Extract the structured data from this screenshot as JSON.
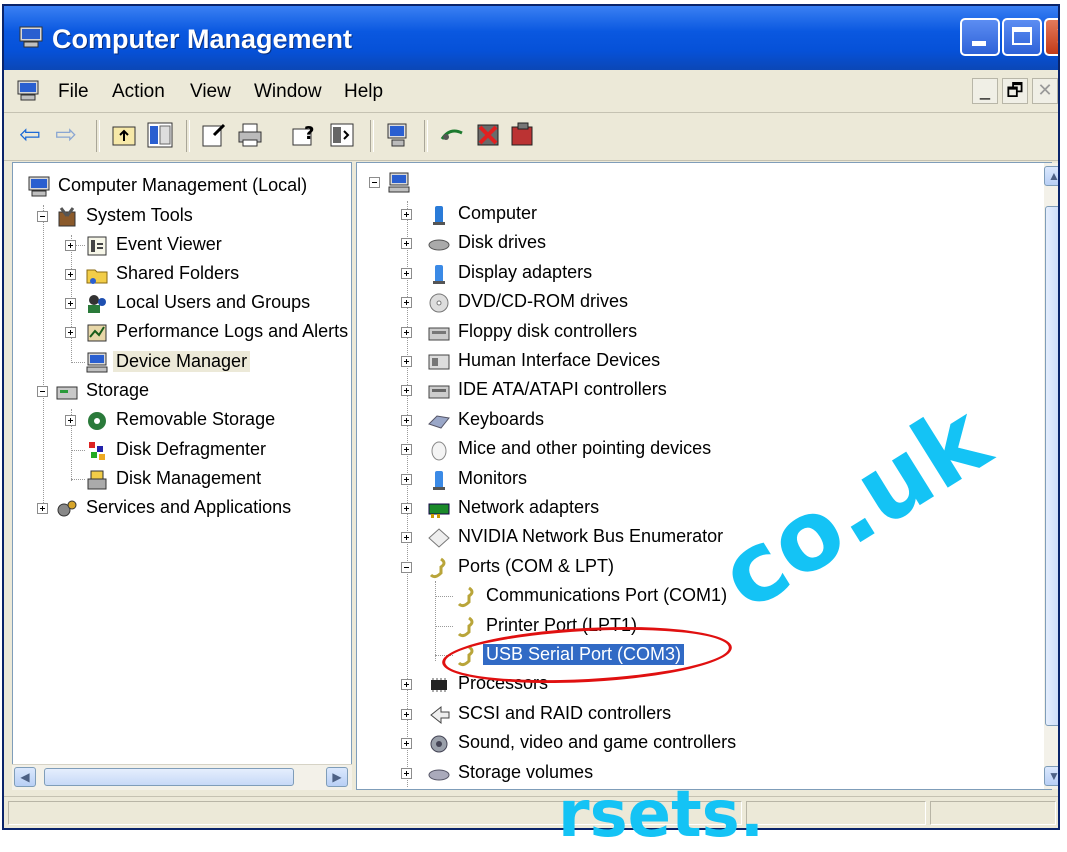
{
  "window": {
    "title": "Computer Management"
  },
  "menu": {
    "items": [
      "File",
      "Action",
      "View",
      "Window",
      "Help"
    ]
  },
  "mdi_controls": [
    "_",
    "🗗",
    "✕"
  ],
  "left_tree": [
    {
      "label": "Computer Management (Local)",
      "icon": "computer-icon",
      "level": 0,
      "expander": "none"
    },
    {
      "label": "System Tools",
      "icon": "tools-icon",
      "level": 1,
      "expander": "minus"
    },
    {
      "label": "Event Viewer",
      "icon": "event-viewer-icon",
      "level": 2,
      "expander": "plus"
    },
    {
      "label": "Shared Folders",
      "icon": "folder-icon",
      "level": 2,
      "expander": "plus"
    },
    {
      "label": "Local Users and Groups",
      "icon": "users-icon",
      "level": 2,
      "expander": "plus"
    },
    {
      "label": "Performance Logs and Alerts",
      "icon": "performance-icon",
      "level": 2,
      "expander": "plus"
    },
    {
      "label": "Device Manager",
      "icon": "device-manager-icon",
      "level": 2,
      "expander": "none",
      "selected": true
    },
    {
      "label": "Storage",
      "icon": "storage-icon",
      "level": 1,
      "expander": "minus"
    },
    {
      "label": "Removable Storage",
      "icon": "removable-storage-icon",
      "level": 2,
      "expander": "plus"
    },
    {
      "label": "Disk Defragmenter",
      "icon": "defrag-icon",
      "level": 2,
      "expander": "none"
    },
    {
      "label": "Disk Management",
      "icon": "disk-management-icon",
      "level": 2,
      "expander": "none"
    },
    {
      "label": "Services and Applications",
      "icon": "services-icon",
      "level": 1,
      "expander": "plus"
    }
  ],
  "device_tree": [
    {
      "label": "Computer",
      "icon": "computer-icon",
      "expander": "plus"
    },
    {
      "label": "Disk drives",
      "icon": "disk-drive-icon",
      "expander": "plus"
    },
    {
      "label": "Display adapters",
      "icon": "display-icon",
      "expander": "plus"
    },
    {
      "label": "DVD/CD-ROM drives",
      "icon": "cdrom-icon",
      "expander": "plus"
    },
    {
      "label": "Floppy disk controllers",
      "icon": "floppy-icon",
      "expander": "plus"
    },
    {
      "label": "Human Interface Devices",
      "icon": "hid-icon",
      "expander": "plus"
    },
    {
      "label": "IDE ATA/ATAPI controllers",
      "icon": "ide-icon",
      "expander": "plus"
    },
    {
      "label": "Keyboards",
      "icon": "keyboard-icon",
      "expander": "plus"
    },
    {
      "label": "Mice and other pointing devices",
      "icon": "mouse-icon",
      "expander": "plus"
    },
    {
      "label": "Monitors",
      "icon": "monitor-icon",
      "expander": "plus"
    },
    {
      "label": "Network adapters",
      "icon": "network-icon",
      "expander": "plus"
    },
    {
      "label": "NVIDIA Network Bus Enumerator",
      "icon": "bus-icon",
      "expander": "plus"
    },
    {
      "label": "Ports (COM & LPT)",
      "icon": "port-icon",
      "expander": "minus"
    },
    {
      "label": "Communications Port (COM1)",
      "icon": "port-icon",
      "expander": "none",
      "child": true
    },
    {
      "label": "Printer Port (LPT1)",
      "icon": "port-icon",
      "expander": "none",
      "child": true
    },
    {
      "label": "USB Serial Port (COM3)",
      "icon": "port-icon",
      "expander": "none",
      "child": true,
      "highlighted": true
    },
    {
      "label": "Processors",
      "icon": "processor-icon",
      "expander": "plus"
    },
    {
      "label": "SCSI and RAID controllers",
      "icon": "scsi-icon",
      "expander": "plus"
    },
    {
      "label": "Sound, video and game controllers",
      "icon": "sound-icon",
      "expander": "plus"
    },
    {
      "label": "Storage volumes",
      "icon": "volume-icon",
      "expander": "plus"
    }
  ],
  "watermark": {
    "text_1": "rsets.",
    "text_2": "co.uk"
  },
  "colors": {
    "titlebar": "#0a58e0",
    "selection": "#316ac5",
    "highlight_ring": "#e01010",
    "watermark": "#14c3f5"
  }
}
